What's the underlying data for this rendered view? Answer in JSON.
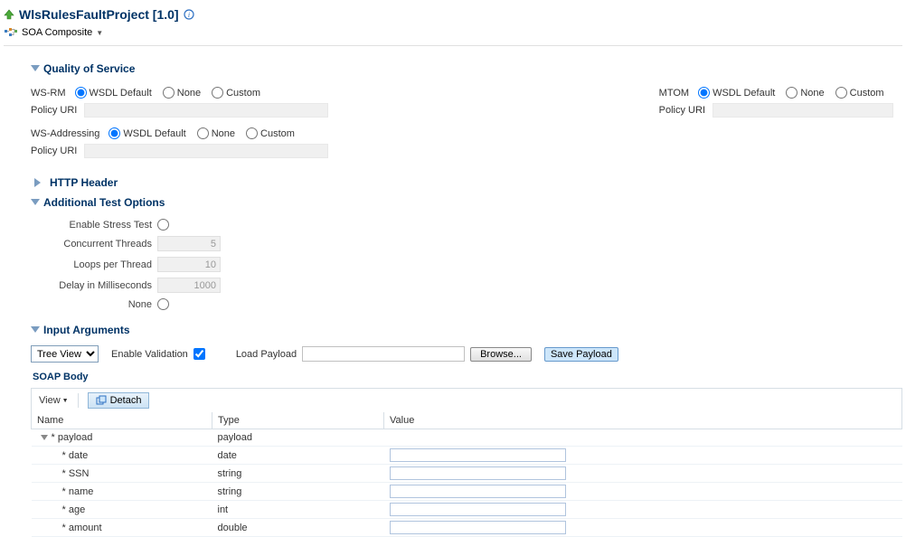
{
  "header": {
    "title": "WlsRulesFaultProject [1.0]",
    "breadcrumb": "SOA Composite"
  },
  "qos": {
    "title": "Quality of Service",
    "wsrm_label": "WS-RM",
    "mtom_label": "MTOM",
    "wsaddr_label": "WS-Addressing",
    "policy_uri_label": "Policy URI",
    "opt_default": "WSDL Default",
    "opt_none": "None",
    "opt_custom": "Custom"
  },
  "http": {
    "title": "HTTP Header"
  },
  "addopts": {
    "title": "Additional Test Options",
    "enable_stress": "Enable Stress Test",
    "concurrent": "Concurrent Threads",
    "concurrent_val": "5",
    "loops": "Loops per Thread",
    "loops_val": "10",
    "delay": "Delay in Milliseconds",
    "delay_val": "1000",
    "none": "None"
  },
  "inputargs": {
    "title": "Input Arguments",
    "treeview_label": "Tree View",
    "enable_validation": "Enable Validation",
    "load_payload": "Load Payload",
    "browse": "Browse...",
    "save_payload": "Save Payload",
    "soap_body": "SOAP Body",
    "view_menu": "View",
    "detach": "Detach",
    "cols": {
      "name": "Name",
      "type": "Type",
      "value": "Value"
    },
    "rows": [
      {
        "name": "* payload",
        "type": "payload",
        "indent": 0,
        "expandable": true,
        "input": false
      },
      {
        "name": "* date",
        "type": "date",
        "indent": 1,
        "expandable": false,
        "input": true
      },
      {
        "name": "* SSN",
        "type": "string",
        "indent": 1,
        "expandable": false,
        "input": true
      },
      {
        "name": "* name",
        "type": "string",
        "indent": 1,
        "expandable": false,
        "input": true
      },
      {
        "name": "* age",
        "type": "int",
        "indent": 1,
        "expandable": false,
        "input": true
      },
      {
        "name": "* amount",
        "type": "double",
        "indent": 1,
        "expandable": false,
        "input": true
      }
    ]
  }
}
